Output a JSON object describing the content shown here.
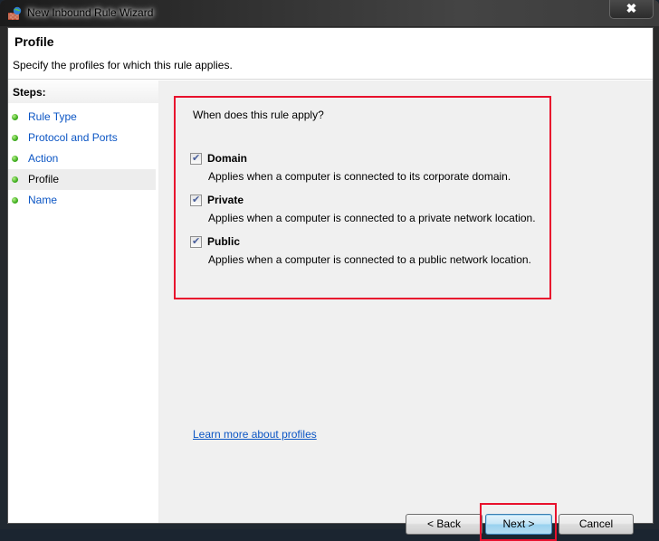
{
  "window": {
    "title": "New Inbound Rule Wizard",
    "icon": "firewall-icon",
    "close_label": "✖"
  },
  "header": {
    "title": "Profile",
    "subtitle": "Specify the profiles for which this rule applies."
  },
  "steps": {
    "heading": "Steps:",
    "items": [
      {
        "label": "Rule Type",
        "active": false
      },
      {
        "label": "Protocol and Ports",
        "active": false
      },
      {
        "label": "Action",
        "active": false
      },
      {
        "label": "Profile",
        "active": true
      },
      {
        "label": "Name",
        "active": false
      }
    ]
  },
  "main": {
    "question": "When does this rule apply?",
    "options": [
      {
        "label": "Domain",
        "description": "Applies when a computer is connected to its corporate domain.",
        "checked": true
      },
      {
        "label": "Private",
        "description": "Applies when a computer is connected to a private network location.",
        "checked": true
      },
      {
        "label": "Public",
        "description": "Applies when a computer is connected to a public network location.",
        "checked": true
      }
    ],
    "learn_more_link": "Learn more about profiles"
  },
  "buttons": {
    "back": "< Back",
    "next": "Next >",
    "cancel": "Cancel"
  },
  "colors": {
    "highlight": "#e8112d",
    "link": "#0b55c4"
  }
}
